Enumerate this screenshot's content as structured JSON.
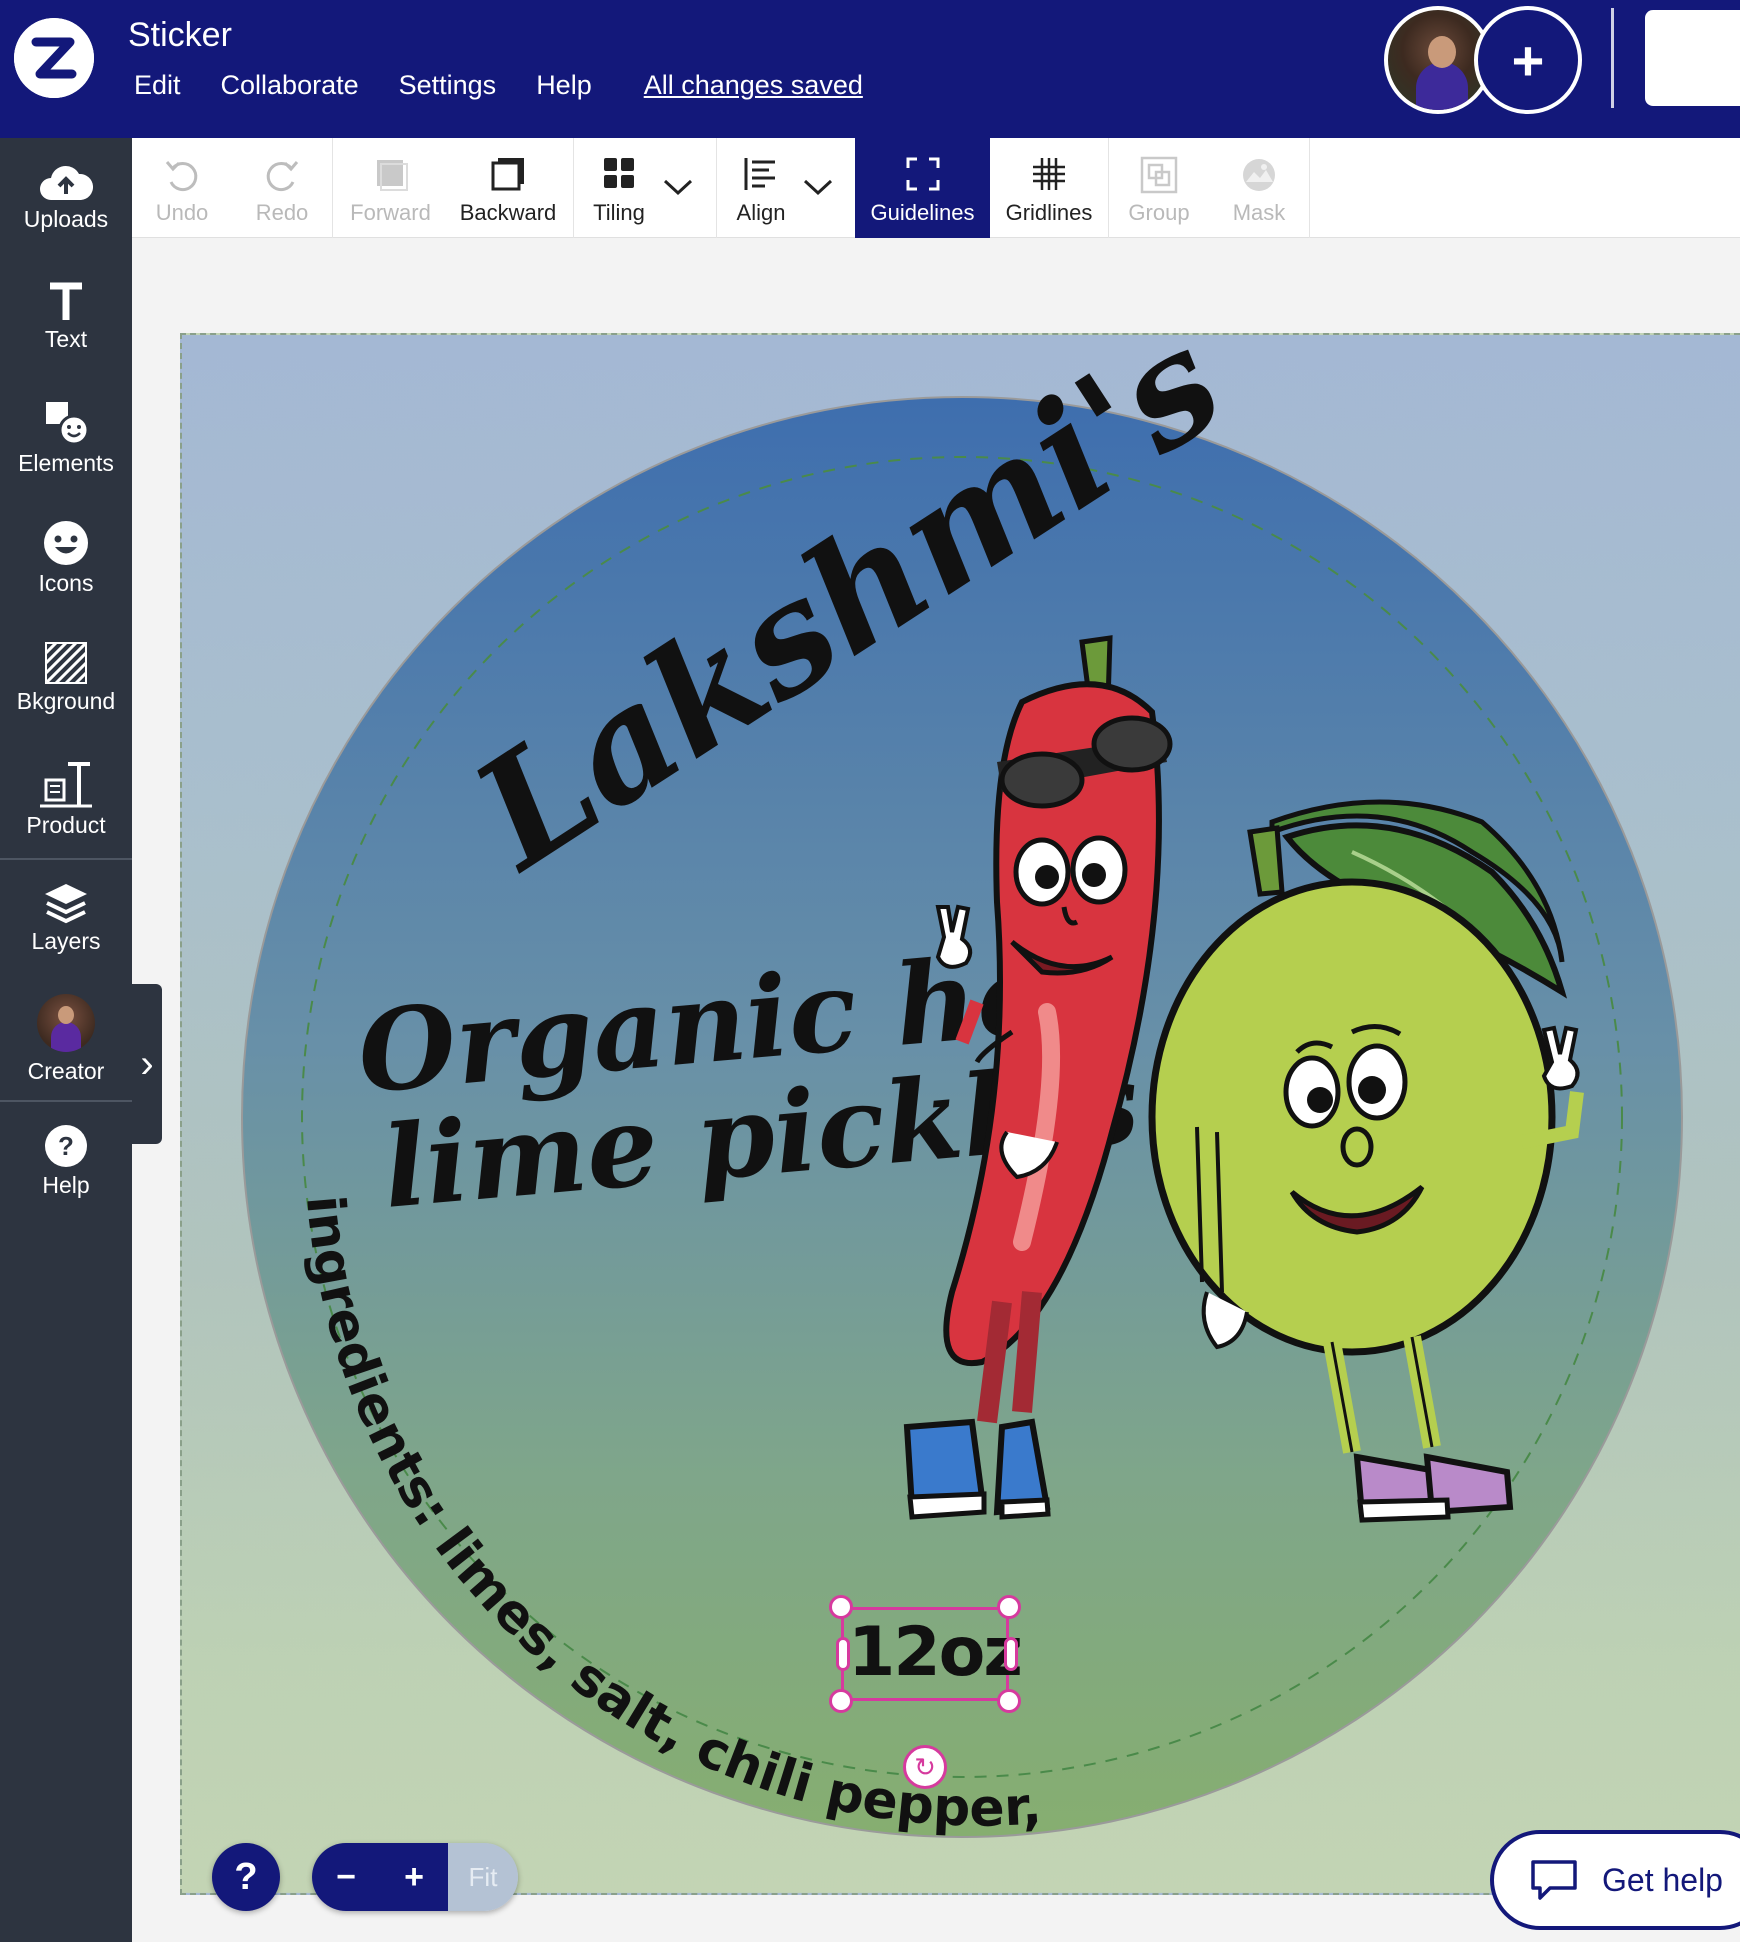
{
  "app": {
    "document_title": "Sticker",
    "save_status": "All changes saved"
  },
  "menu": {
    "items": [
      "Edit",
      "Collaborate",
      "Settings",
      "Help"
    ]
  },
  "sidebar": {
    "items": [
      {
        "label": "Uploads",
        "icon": "cloud-upload-icon"
      },
      {
        "label": "Text",
        "icon": "text-icon"
      },
      {
        "label": "Elements",
        "icon": "elements-icon"
      },
      {
        "label": "Icons",
        "icon": "smiley-icon"
      },
      {
        "label": "Bkground",
        "icon": "background-pattern-icon"
      },
      {
        "label": "Product",
        "icon": "product-icon"
      },
      {
        "label": "Layers",
        "icon": "layers-icon"
      },
      {
        "label": "Creator",
        "icon": "creator-avatar"
      },
      {
        "label": "Help",
        "icon": "help-icon"
      }
    ]
  },
  "toolbar": {
    "undo": "Undo",
    "redo": "Redo",
    "forward": "Forward",
    "backward": "Backward",
    "tiling": "Tiling",
    "align": "Align",
    "guidelines": "Guidelines",
    "gridlines": "Gridlines",
    "group": "Group",
    "mask": "Mask"
  },
  "design": {
    "brand": "Lakshmi's",
    "tagline_1": "Organic hot",
    "tagline_2": "lime pickles",
    "ingredients": "ingredients: limes, salt, chili pepper, spices",
    "size": "12oz"
  },
  "bottom": {
    "help": "?",
    "zoom_out": "−",
    "zoom_in": "+",
    "fit": "Fit",
    "get_help": "Get help"
  },
  "colors": {
    "header": "#13187a",
    "sidebar": "#2d3440",
    "selection": "#d63a9e",
    "pepper": "#d8343f",
    "lime": "#b5cf4f"
  }
}
